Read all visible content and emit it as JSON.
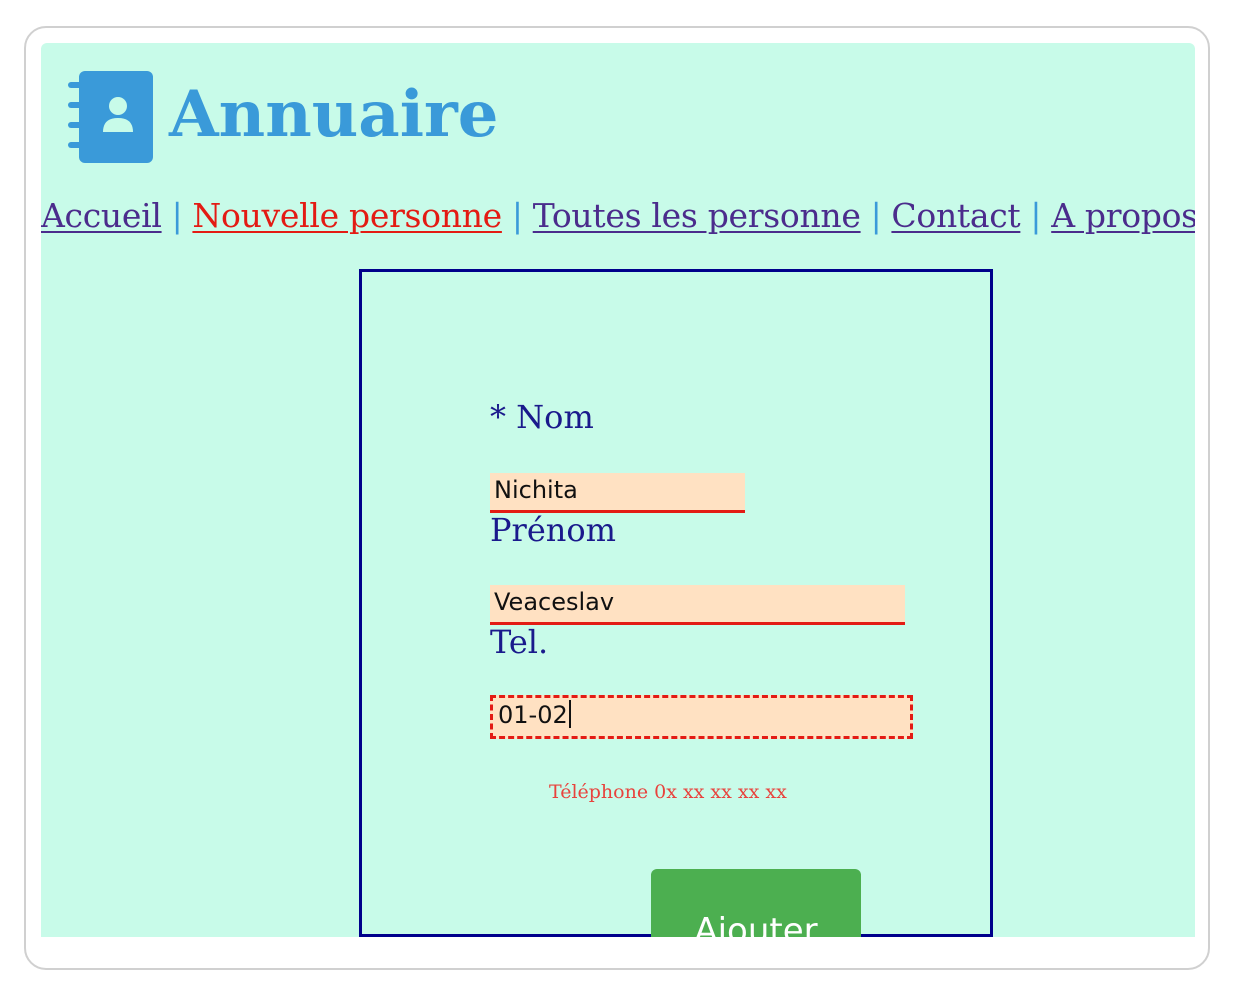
{
  "header": {
    "title": "Annuaire",
    "logo_icon": "address-book-icon",
    "brand_color": "#3a9ad9"
  },
  "nav": {
    "items": [
      {
        "label": "Accueil",
        "active": false
      },
      {
        "label": "Nouvelle personne",
        "active": true
      },
      {
        "label": "Toutes les personne",
        "active": false
      },
      {
        "label": "Contact",
        "active": false
      },
      {
        "label": "A propos",
        "active": false
      }
    ],
    "separator": "|"
  },
  "form": {
    "nom": {
      "label": "* Nom",
      "value": "Nichita"
    },
    "prenom": {
      "label": "Prénom",
      "value": "Veaceslav"
    },
    "tel": {
      "label": "Tel.",
      "value": "01-02",
      "hint": "Téléphone 0x xx xx xx xx",
      "state": "invalid"
    },
    "submit_label": "Ajouter"
  },
  "colors": {
    "background": "#c8fbe9",
    "link": "#4b2c8c",
    "active_link": "#e31b14",
    "error": "#e31b14",
    "input_bg": "#ffe1c2",
    "button": "#4caf50",
    "form_border": "#00008b"
  }
}
